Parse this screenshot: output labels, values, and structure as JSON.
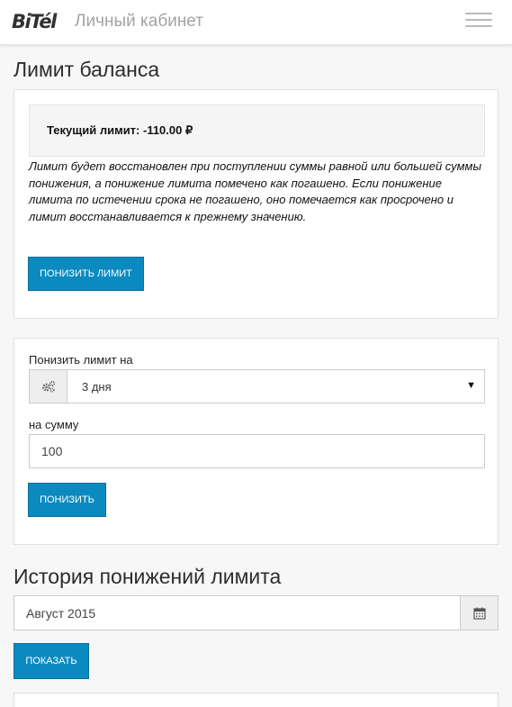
{
  "header": {
    "logo": "BiTél",
    "title": "Личный кабинет"
  },
  "limit_section": {
    "title": "Лимит баланса",
    "current_limit": "Текущий лимит: -110.00 ₽",
    "note": "Лимит будет восстановлен при поступлении суммы равной или большей суммы понижения, а понижение лимита помечено как погашено. Если понижение лимита по истечении срока не погашено, оно помечается как просрочено и лимит восстанавливается к прежнему значению.",
    "lower_button": "Понизить лимит"
  },
  "lower_form": {
    "period_label": "Понизить лимит на",
    "period_value": "3 дня",
    "amount_label": "на сумму",
    "amount_value": "100",
    "submit_button": "Понизить"
  },
  "history": {
    "title": "История понижений лимита",
    "month_value": "Август 2015",
    "show_button": "Показать"
  },
  "icons": {
    "menu": "hamburger-menu-icon",
    "period_addon": "gears-icon",
    "select_caret": "caret-down-icon",
    "calendar": "calendar-icon"
  },
  "colors": {
    "accent": "#0b8ac0",
    "background": "#f7f7f7"
  }
}
